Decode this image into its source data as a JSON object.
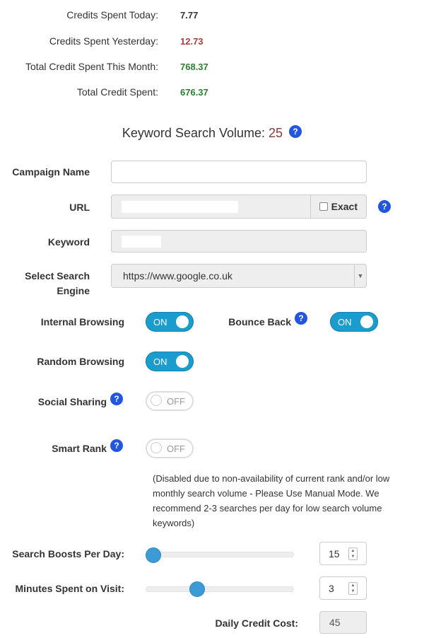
{
  "credits": {
    "today_label": "Credits Spent Today:",
    "today_value": "7.77",
    "yesterday_label": "Credits Spent Yesterday:",
    "yesterday_value": "12.73",
    "month_label": "Total Credit Spent This Month:",
    "month_value": "768.37",
    "total_label": "Total Credit Spent:",
    "total_value": "676.37"
  },
  "colors": {
    "positive": "#2e7d32",
    "negative": "#b23a3a",
    "dark": "#333333",
    "toggle_on": "#1a9ccd",
    "help": "#2255e0",
    "slider": "#3c9bd6"
  },
  "keyword_volume": {
    "label": "Keyword Search Volume:",
    "value": "25",
    "help": "?"
  },
  "form": {
    "campaign_name_label": "Campaign Name",
    "campaign_name_value": "",
    "url_label": "URL",
    "url_value": "",
    "exact_label": "Exact",
    "keyword_label": "Keyword",
    "keyword_value": "",
    "search_engine_label": "Select Search Engine",
    "search_engine_value": "https://www.google.co.uk",
    "internal_browsing_label": "Internal Browsing",
    "internal_browsing_state": "ON",
    "bounce_back_label": "Bounce Back",
    "bounce_back_state": "ON",
    "random_browsing_label": "Random Browsing",
    "random_browsing_state": "ON",
    "social_sharing_label": "Social Sharing",
    "social_sharing_state": "OFF",
    "smart_rank_label": "Smart Rank",
    "smart_rank_state": "OFF",
    "smart_rank_note": "(Disabled due to non-availability of current rank and/or low monthly search volume - Please Use Manual Mode. We recommend 2-3 searches per day for low search volume keywords)",
    "help": "?"
  },
  "boosts": {
    "label": "Search Boosts Per Day:",
    "value": "15",
    "slider_fraction": 0.0
  },
  "minutes": {
    "label": "Minutes Spent on Visit:",
    "value": "3",
    "slider_fraction": 0.33
  },
  "daily_cost": {
    "label": "Daily Credit Cost:",
    "value": "45"
  },
  "icons": {
    "help": "question-circle-icon",
    "spinner": "up-down-arrows-icon",
    "select": "caret-down-icon"
  }
}
